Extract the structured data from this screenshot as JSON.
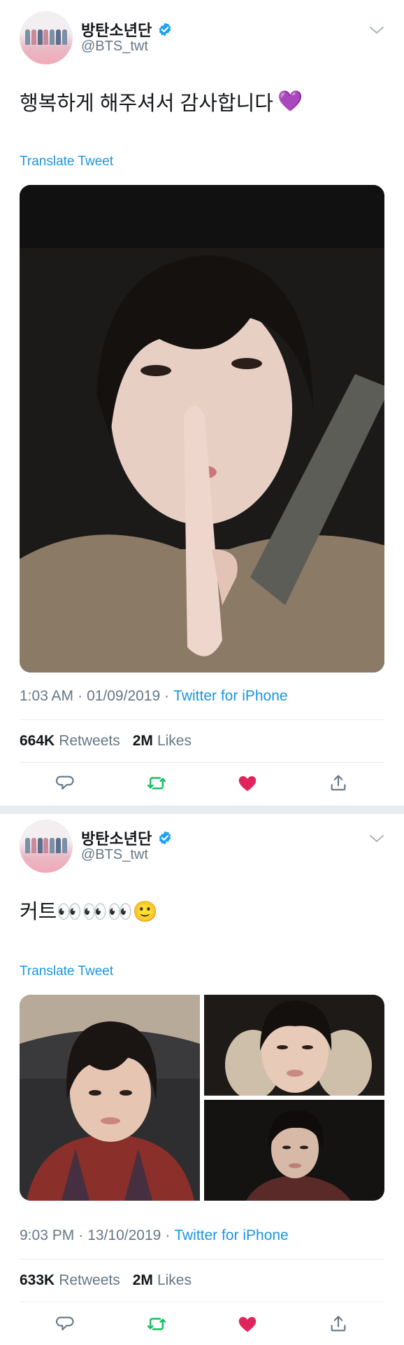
{
  "tweets": [
    {
      "display_name": "방탄소년단",
      "handle": "@BTS_twt",
      "text": "행복하게 해주셔서 감사합니다",
      "emoji": "💜",
      "translate_label": "Translate Tweet",
      "time": "1:03 AM",
      "date": "01/09/2019",
      "source": "Twitter for iPhone",
      "separator": "·",
      "retweets_count": "664K",
      "retweets_label": "Retweets",
      "likes_count": "2M",
      "likes_label": "Likes",
      "media_count": 1
    },
    {
      "display_name": "방탄소년단",
      "handle": "@BTS_twt",
      "text": "커트👀👀👀🙂",
      "emoji": "",
      "translate_label": "Translate Tweet",
      "time": "9:03 PM",
      "date": "13/10/2019",
      "source": "Twitter for iPhone",
      "separator": "·",
      "retweets_count": "633K",
      "retweets_label": "Retweets",
      "likes_count": "2M",
      "likes_label": "Likes",
      "media_count": 3
    }
  ],
  "icons": {
    "verified": "verified-badge-icon",
    "caret": "chevron-down-icon",
    "reply": "reply-icon",
    "retweet": "retweet-icon",
    "like": "heart-icon",
    "share": "share-icon"
  },
  "colors": {
    "link": "#1b95e0",
    "retweet_green": "#17bf63",
    "like_red": "#e0245e",
    "secondary_text": "#657786",
    "divider": "#e6ecf0"
  }
}
